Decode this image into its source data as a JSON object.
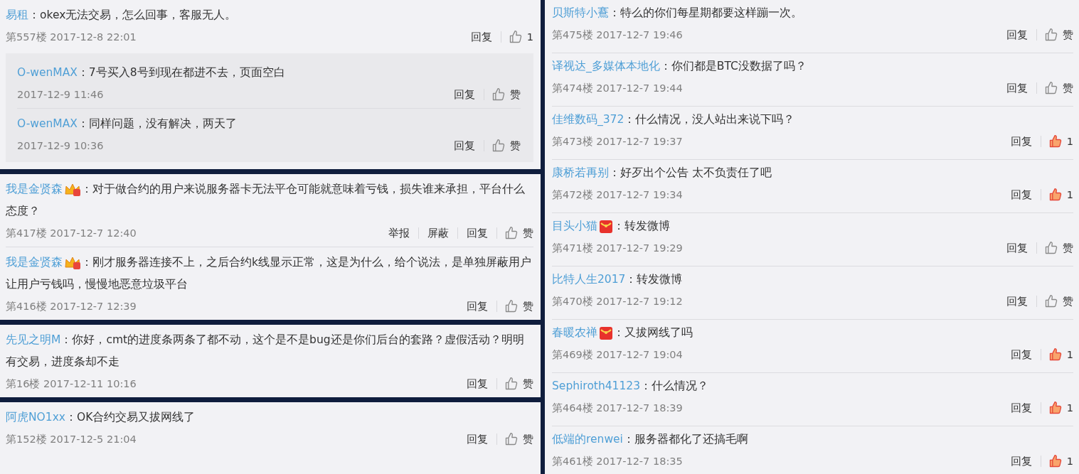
{
  "left_panels": [
    {
      "comments": [
        {
          "author": "易租",
          "text": "：okex无法交易，怎么回事，客服无人。",
          "meta": "第557楼 2017-12-8 22:01",
          "actions": [
            "回复"
          ],
          "like": {
            "label": "1",
            "liked": false
          },
          "replies": [
            {
              "author": "O-wenMAX",
              "text": "：7号买入8号到现在都进不去，页面空白",
              "meta": "2017-12-9 11:46",
              "actions": [
                "回复"
              ],
              "like": {
                "label": "赞",
                "liked": false
              }
            },
            {
              "author": "O-wenMAX",
              "text": "：同样问题，没有解决，两天了",
              "meta": "2017-12-9 10:36",
              "actions": [
                "回复"
              ],
              "like": {
                "label": "赞",
                "liked": false
              }
            }
          ]
        }
      ]
    },
    {
      "comments": [
        {
          "author": "我是金贤森",
          "badge": {
            "kind": "crown"
          },
          "text": "：对于做合约的用户来说服务器卡无法平仓可能就意味着亏钱，损失谁来承担，平台什么态度？",
          "meta": "第417楼 2017-12-7 12:40",
          "actions": [
            "举报",
            "屏蔽",
            "回复"
          ],
          "like": {
            "label": "赞",
            "liked": false
          }
        },
        {
          "author": "我是金贤森",
          "badge": {
            "kind": "crown"
          },
          "text": "：刚才服务器连接不上，之后合约k线显示正常，这是为什么，给个说法，是单独屏蔽用户让用户亏钱吗，慢慢地恶意垃圾平台",
          "meta": "第416楼 2017-12-7 12:39",
          "actions": [
            "回复"
          ],
          "like": {
            "label": "赞",
            "liked": false
          }
        }
      ]
    },
    {
      "comments": [
        {
          "author": "先见之明M",
          "text": "：你好，cmt的进度条两条了都不动，这个是不是bug还是你们后台的套路？虚假活动？明明有交易，进度条却不走",
          "meta": "第16楼 2017-12-11 10:16",
          "actions": [
            "回复"
          ],
          "like": {
            "label": "赞",
            "liked": false
          }
        }
      ]
    },
    {
      "comments": [
        {
          "author": "阿虎NO1xx",
          "text": "：OK合约交易又拔网线了",
          "meta": "第152楼 2017-12-5 21:04",
          "actions": [
            "回复"
          ],
          "like": {
            "label": "赞",
            "liked": false
          }
        }
      ]
    }
  ],
  "right_panel": {
    "comments": [
      {
        "author": "贝斯特小鶱",
        "text": "：特么的你们每星期都要这样蹦一次。",
        "meta": "第475楼 2017-12-7 19:46",
        "actions": [
          "回复"
        ],
        "like": {
          "label": "赞",
          "liked": false
        }
      },
      {
        "author": "译视达_多媒体本地化",
        "text": "：你们都是BTC没数据了吗？",
        "meta": "第474楼 2017-12-7 19:44",
        "actions": [
          "回复"
        ],
        "like": {
          "label": "赞",
          "liked": false
        }
      },
      {
        "author": "佳维数码_372",
        "text": "：什么情况，没人站出来说下吗？",
        "meta": "第473楼 2017-12-7 19:37",
        "actions": [
          "回复"
        ],
        "like": {
          "label": "1",
          "liked": true
        }
      },
      {
        "author": "康桥若再别",
        "text": "：好歹出个公告 太不负责任了吧",
        "meta": "第472楼 2017-12-7 19:34",
        "actions": [
          "回复"
        ],
        "like": {
          "label": "1",
          "liked": true
        }
      },
      {
        "author": "目头小猫",
        "badge": {
          "kind": "envelope"
        },
        "text": "：转发微博",
        "meta": "第471楼 2017-12-7 19:29",
        "actions": [
          "回复"
        ],
        "like": {
          "label": "赞",
          "liked": false
        }
      },
      {
        "author": "比特人生2017",
        "text": "：转发微博",
        "meta": "第470楼 2017-12-7 19:12",
        "actions": [
          "回复"
        ],
        "like": {
          "label": "赞",
          "liked": false
        }
      },
      {
        "author": "春暖农禅",
        "badge": {
          "kind": "envelope"
        },
        "text": "：又拔网线了吗",
        "meta": "第469楼 2017-12-7 19:04",
        "actions": [
          "回复"
        ],
        "like": {
          "label": "1",
          "liked": true
        }
      },
      {
        "author": "Sephiroth41123",
        "text": "：什么情况？",
        "meta": "第464楼 2017-12-7 18:39",
        "actions": [
          "回复"
        ],
        "like": {
          "label": "1",
          "liked": true
        }
      },
      {
        "author": "低端的renwei",
        "text": "：服务器都化了还搞毛啊",
        "meta": "第461楼 2017-12-7 18:35",
        "actions": [
          "回复"
        ],
        "like": {
          "label": "1",
          "liked": true
        }
      }
    ]
  }
}
